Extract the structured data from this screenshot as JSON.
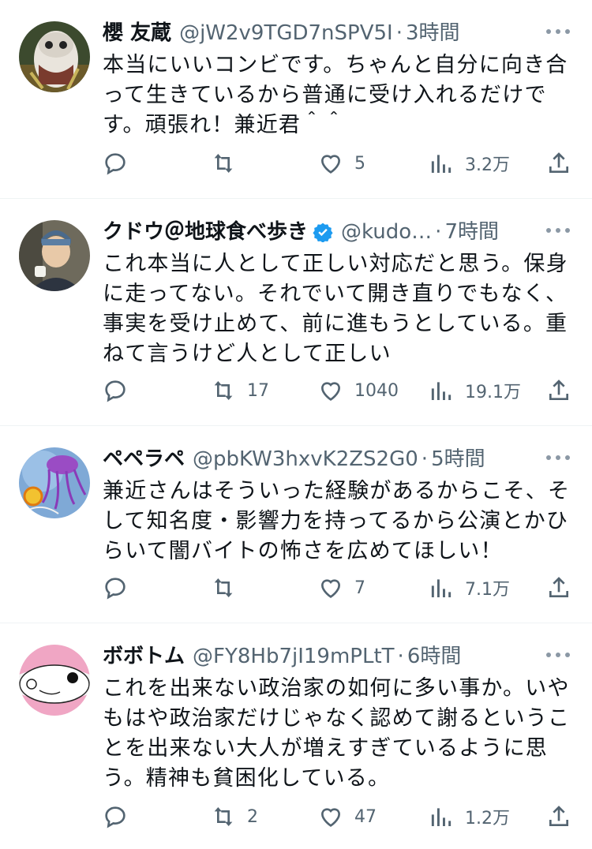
{
  "tweets": [
    {
      "name": "櫻 友蔵",
      "handle": "@jW2v9TGD7nSPV5I",
      "time": "3時間",
      "text": "本当にいいコンビです。ちゃんと自分に向き合って生きているから普通に受け入れるだけです。頑張れ！兼近君＾＾",
      "replies": "",
      "retweets": "",
      "likes": "5",
      "views": "3.2万",
      "verified": false
    },
    {
      "name": "クドウ＠地球食べ歩き",
      "handle": "@kudo…",
      "time": "7時間",
      "text": "これ本当に人として正しい対応だと思う。保身に走ってない。それでいて開き直りでもなく、事実を受け止めて、前に進もうとしている。重ねて言うけど人として正しい",
      "replies": "",
      "retweets": "17",
      "likes": "1040",
      "views": "19.1万",
      "verified": true
    },
    {
      "name": "ペペラペ",
      "handle": "@pbKW3hxvK2ZS2G0",
      "time": "5時間",
      "text": "兼近さんはそういった経験があるからこそ、そして知名度・影響力を持ってるから公演とかひらいて闇バイトの怖さを広めてほしい！",
      "replies": "",
      "retweets": "",
      "likes": "7",
      "views": "7.1万",
      "verified": false
    },
    {
      "name": "ボボトム",
      "handle": "@FY8Hb7jI19mPLtT",
      "time": "6時間",
      "text": "これを出来ない政治家の如何に多い事か。いやもはや政治家だけじゃなく認めて謝るということを出来ない大人が増えすぎているように思う。精神も貧困化している。",
      "replies": "",
      "retweets": "2",
      "likes": "47",
      "views": "1.2万",
      "verified": false
    }
  ],
  "colors": {
    "text": "#0f1419",
    "secondary": "#536471",
    "verified": "#1d9bf0",
    "divider": "#eff3f4"
  },
  "icons": [
    "reply-icon",
    "retweet-icon",
    "like-icon",
    "views-icon",
    "share-icon",
    "more-icon",
    "verified-icon"
  ]
}
